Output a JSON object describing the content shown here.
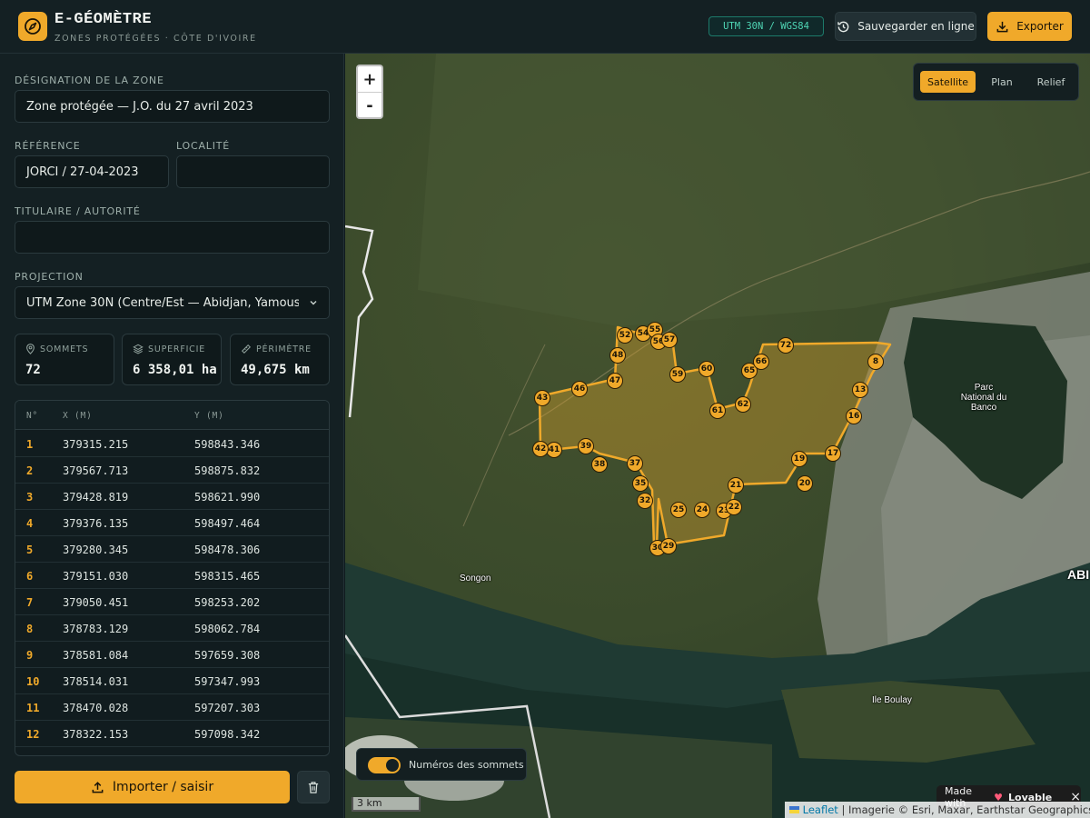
{
  "header": {
    "title": "E-GÉOMÈTRE",
    "subtitle": "ZONES PROTÉGÉES · CÔTE D'IVOIRE",
    "projection_badge": "UTM 30N / WGS84",
    "save_label": "Sauvegarder en ligne",
    "export_label": "Exporter"
  },
  "form": {
    "designation_label": "DÉSIGNATION DE LA ZONE",
    "designation_value": "Zone protégée — J.O. du 27 avril 2023",
    "reference_label": "RÉFÉRENCE",
    "reference_value": "JORCI / 27-04-2023",
    "locality_label": "LOCALITÉ",
    "locality_value": "",
    "holder_label": "TITULAIRE / AUTORITÉ",
    "holder_value": "",
    "projection_label": "PROJECTION",
    "projection_value": "UTM Zone 30N (Centre/Est — Abidjan, Yamoussoukro)"
  },
  "stats": {
    "vertices_label": "SOMMETS",
    "vertices_value": "72",
    "area_label": "SUPERFICIE",
    "area_value": "6 358,01 ha",
    "perimeter_label": "PÉRIMÈTRE",
    "perimeter_value": "49,675 km"
  },
  "table": {
    "headers": [
      "N°",
      "X (M)",
      "Y (M)"
    ],
    "rows": [
      {
        "n": "1",
        "x": "379315.215",
        "y": "598843.346"
      },
      {
        "n": "2",
        "x": "379567.713",
        "y": "598875.832"
      },
      {
        "n": "3",
        "x": "379428.819",
        "y": "598621.990"
      },
      {
        "n": "4",
        "x": "379376.135",
        "y": "598497.464"
      },
      {
        "n": "5",
        "x": "379280.345",
        "y": "598478.306"
      },
      {
        "n": "6",
        "x": "379151.030",
        "y": "598315.465"
      },
      {
        "n": "7",
        "x": "379050.451",
        "y": "598253.202"
      },
      {
        "n": "8",
        "x": "378783.129",
        "y": "598062.784"
      },
      {
        "n": "9",
        "x": "378581.084",
        "y": "597659.308"
      },
      {
        "n": "10",
        "x": "378514.031",
        "y": "597347.993"
      },
      {
        "n": "11",
        "x": "378470.028",
        "y": "597207.303"
      },
      {
        "n": "12",
        "x": "378322.153",
        "y": "597098.342"
      }
    ]
  },
  "actions": {
    "import_label": "Importer / saisir"
  },
  "map": {
    "zoom_in": "+",
    "zoom_out": "-",
    "layers": [
      "Satellite",
      "Plan",
      "Relief"
    ],
    "active_layer": "Satellite",
    "vertex_toggle_label": "Numéros des sommets",
    "vertex_toggle_on": true,
    "scale_label": "3 km",
    "made_with_prefix": "Made with",
    "made_with_brand": "Lovable",
    "made_with_close": "×",
    "attribution_link": "Leaflet",
    "attribution_text": " | Imagerie © Esri, Maxar, Earthstar Geographics",
    "places": {
      "park": "Parc National du Banco",
      "songon": "Songon",
      "ile_boulay": "Ile Boulay",
      "abidjan": "ABI"
    },
    "vertex_labels": [
      "72",
      "65",
      "66",
      "59",
      "60",
      "61",
      "62",
      "52",
      "54",
      "55",
      "56",
      "57",
      "48",
      "47",
      "46",
      "43",
      "41",
      "42",
      "39",
      "38",
      "37",
      "35",
      "32",
      "30",
      "29",
      "25",
      "24",
      "23",
      "22",
      "21",
      "20",
      "19",
      "17",
      "16",
      "13",
      "8"
    ]
  },
  "colors": {
    "accent": "#f0a92a",
    "panel": "#142023",
    "badge_text": "#4fd6b5"
  }
}
